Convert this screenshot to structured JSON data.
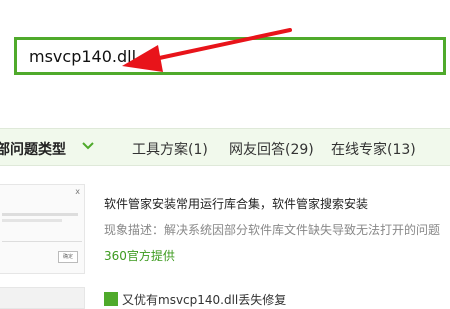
{
  "search": {
    "value": "msvcp140.dll"
  },
  "tabs": {
    "active_label": "部问题类型",
    "items": [
      {
        "label": "工具方案(1)"
      },
      {
        "label": "网友回答(29)"
      },
      {
        "label": "在线专家(13)"
      }
    ]
  },
  "result": {
    "title": "软件管家安装常用运行库合集，软件管家搜索安装",
    "description": "现象描述：解决系统因部分软件库文件缺失导致无法打开的问题",
    "source": "360官方提供",
    "thumbnail": {
      "close": "x",
      "button": "确定"
    }
  },
  "next_result": {
    "title": "又优有msvcp140.dll丢失修复"
  },
  "colors": {
    "accent": "#4faa2b",
    "arrow": "#e8141a",
    "tab_bg": "#f1f9ec"
  }
}
